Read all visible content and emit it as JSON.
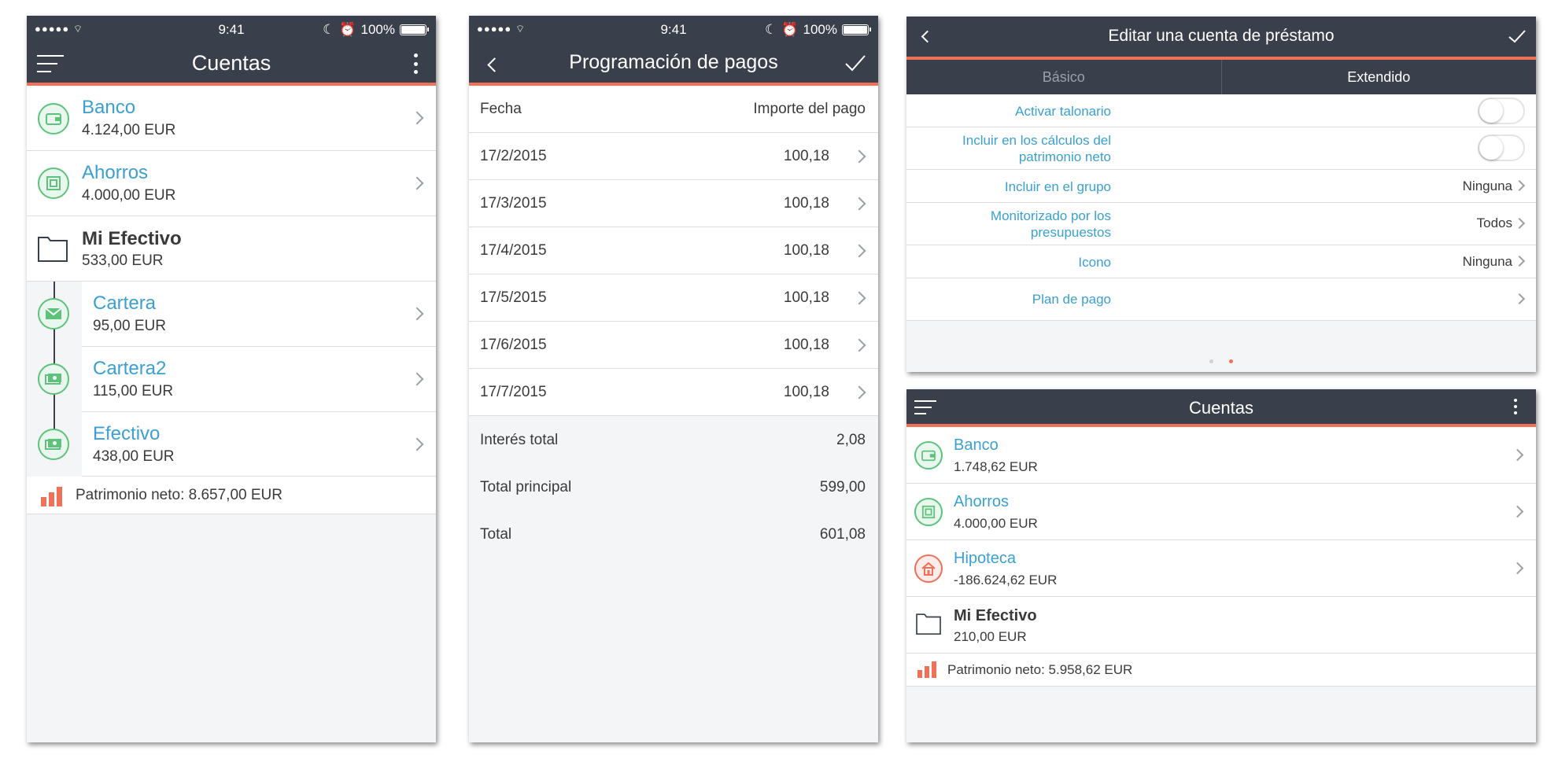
{
  "status": {
    "time": "9:41",
    "battery": "100%"
  },
  "screen1": {
    "title": "Cuentas",
    "accounts": [
      {
        "name": "Banco",
        "value": "4.124,00 EUR",
        "icon": "wallet-icon"
      },
      {
        "name": "Ahorros",
        "value": "4.000,00 EUR",
        "icon": "safe-icon"
      }
    ],
    "folder": {
      "name": "Mi Efectivo",
      "value": "533,00 EUR"
    },
    "children": [
      {
        "name": "Cartera",
        "value": "95,00 EUR",
        "icon": "envelope-icon"
      },
      {
        "name": "Cartera2",
        "value": "115,00 EUR",
        "icon": "cash-icon"
      },
      {
        "name": "Efectivo",
        "value": "438,00 EUR",
        "icon": "cash-icon"
      }
    ],
    "net_worth": "Patrimonio neto: 8.657,00 EUR"
  },
  "screen2": {
    "title": "Programación de pagos",
    "header": {
      "date": "Fecha",
      "amount": "Importe del pago"
    },
    "payments": [
      {
        "date": "17/2/2015",
        "amount": "100,18"
      },
      {
        "date": "17/3/2015",
        "amount": "100,18"
      },
      {
        "date": "17/4/2015",
        "amount": "100,18"
      },
      {
        "date": "17/5/2015",
        "amount": "100,18"
      },
      {
        "date": "17/6/2015",
        "amount": "100,18"
      },
      {
        "date": "17/7/2015",
        "amount": "100,18"
      }
    ],
    "totals": [
      {
        "label": "Interés total",
        "value": "2,08"
      },
      {
        "label": "Total principal",
        "value": "599,00"
      },
      {
        "label": "Total",
        "value": "601,08"
      }
    ]
  },
  "screen3": {
    "title": "Editar una cuenta de préstamo",
    "tabs": [
      "Básico",
      "Extendido"
    ],
    "settings": [
      {
        "label": "Activar talonario",
        "value": ""
      },
      {
        "label": "Incluir en los cálculos del patrimonio neto",
        "value": ""
      },
      {
        "label": "Incluir en el grupo",
        "value": "Ninguna"
      },
      {
        "label": "Monitorizado por los presupuestos",
        "value": "Todos"
      },
      {
        "label": "Icono",
        "value": "Ninguna"
      },
      {
        "label": "Plan de pago",
        "value": ""
      }
    ]
  },
  "screen4": {
    "title": "Cuentas",
    "accounts": [
      {
        "name": "Banco",
        "value": "1.748,62 EUR",
        "icon": "wallet-icon"
      },
      {
        "name": "Ahorros",
        "value": "4.000,00 EUR",
        "icon": "safe-icon"
      },
      {
        "name": "Hipoteca",
        "value": "-186.624,62 EUR",
        "icon": "house-icon"
      }
    ],
    "folder": {
      "name": "Mi Efectivo",
      "value": "210,00 EUR"
    },
    "net_worth": "Patrimonio neto: 5.958,62 EUR"
  },
  "colors": {
    "navbar": "#3a404b",
    "accent": "#f07058",
    "link": "#3aa0d2",
    "icon_green": "#5dc27a"
  }
}
